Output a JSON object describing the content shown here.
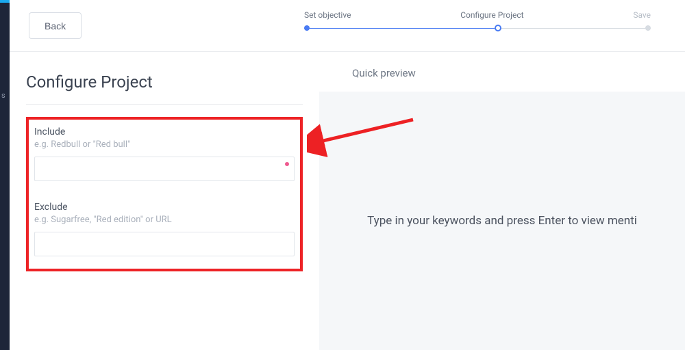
{
  "header": {
    "back_label": "Back",
    "steps": {
      "s1": "Set objective",
      "s2": "Configure Project",
      "s3": "Save"
    }
  },
  "left": {
    "title": "Configure Project",
    "include": {
      "label": "Include",
      "hint": "e.g. Redbull or \"Red bull\"",
      "value": ""
    },
    "exclude": {
      "label": "Exclude",
      "hint": "e.g. Sugarfree, \"Red edition\" or URL",
      "value": ""
    }
  },
  "right": {
    "preview_title": "Quick preview",
    "preview_body": "Type in your keywords and press Enter to view menti"
  },
  "sidebar": {
    "hint": "s"
  }
}
